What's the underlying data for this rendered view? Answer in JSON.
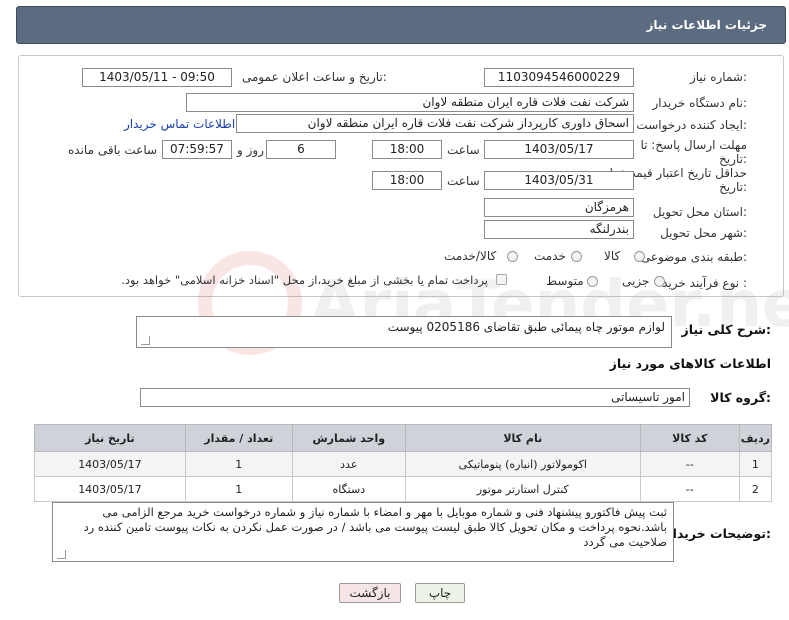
{
  "header": {
    "title": "جزئیات اطلاعات نیاز"
  },
  "form": {
    "need_number_label": "شماره نیاز:",
    "need_number": "1103094546000229",
    "announce_label": "تاریخ و ساعت اعلان عمومی:",
    "announce_value": "1403/05/11 - 09:50",
    "buyer_org_label": "نام دستگاه خریدار:",
    "buyer_org": "شرکت نفت فلات قاره ایران منطقه لاوان",
    "creator_label": "ایجاد کننده درخواست:",
    "creator": "اسحاق داوری کارپرداز شرکت نفت فلات قاره ایران منطقه لاوان",
    "contact_link": "اطلاعات تماس خریدار",
    "reply_deadline_label_1": "مهلت ارسال پاسخ: تا",
    "reply_deadline_label_2": "تاریخ:",
    "reply_date": "1403/05/17",
    "time_label": "ساعت",
    "reply_time": "18:00",
    "days_value": "6",
    "days_label": "روز و",
    "remaining_time": "07:59:57",
    "remaining_label": "ساعت باقی مانده",
    "price_validity_label_1": "حداقل تاریخ اعتبار قیمت: تا",
    "price_validity_label_2": "تاریخ:",
    "price_date": "1403/05/31",
    "price_time": "18:00",
    "province_label": "استان محل تحویل:",
    "province": "هرمزگان",
    "city_label": "شهر محل تحویل:",
    "city": "بندرلنگه",
    "category_label": "طبقه بندی موضوعی:",
    "category_options": [
      "کالا",
      "خدمت",
      "کالا/خدمت"
    ],
    "purchase_type_label": "نوع فرآیند خرید :",
    "purchase_options": [
      "جزیی",
      "متوسط"
    ],
    "treasury_note": "پرداخت تمام یا بخشی از مبلغ خرید،از محل \"اسناد خزانه اسلامی\" خواهد بود."
  },
  "summary": {
    "label": "شرح کلی نیاز:",
    "value": "لوازم موتور چاه پیمائی طبق تقاضای 0205186 پیوست"
  },
  "goods_section": {
    "title": "اطلاعات کالاهای مورد نیاز",
    "group_label": "گروه کالا:",
    "group_value": "امور تاسیساتی"
  },
  "table": {
    "headers": [
      "ردیف",
      "کد کالا",
      "نام کالا",
      "واحد شمارش",
      "تعداد / مقدار",
      "تاریخ نیاز"
    ],
    "rows": [
      [
        "1",
        "--",
        "اکومولاتور (انباره) پنوماتیکی",
        "عدد",
        "1",
        "1403/05/17"
      ],
      [
        "2",
        "--",
        "کنترل استارتر موتور",
        "دستگاه",
        "1",
        "1403/05/17"
      ]
    ]
  },
  "buyer_notes": {
    "label": "توضیحات خریدار:",
    "text": "ثبت پیش فاکتورو پیشنهاد فنی و شماره موبایل با مهر و امضاء با شماره نیاز و شماره درخواست خرید مرجع الزامی می باشد.نحوه پرداخت و مکان تحویل کالا طبق لیست پیوست می باشد / در صورت عمل نکردن به نکات پیوست تامین کننده رد صلاحیت می گردد"
  },
  "buttons": {
    "print": "چاپ",
    "back": "بازگشت"
  },
  "watermark_text": "AriaTender.net"
}
